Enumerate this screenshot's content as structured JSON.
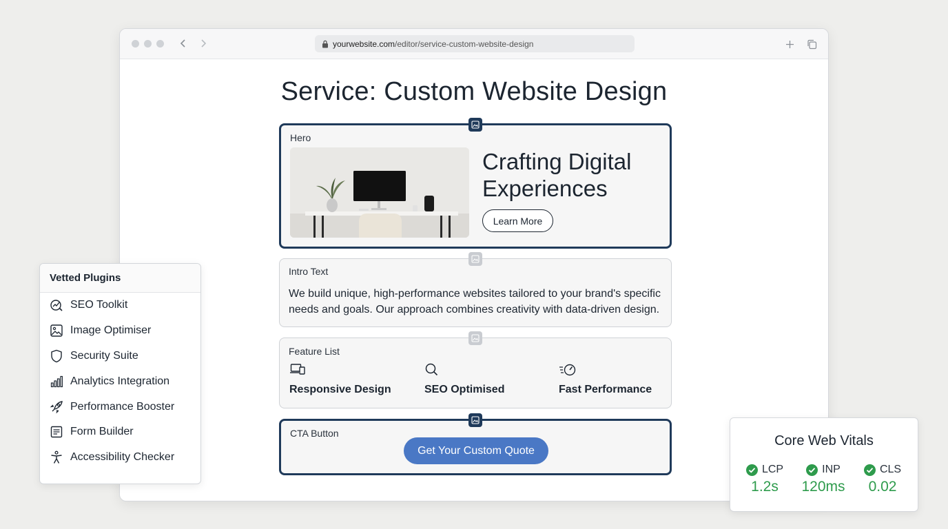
{
  "browser": {
    "url_host": "yourwebsite.com",
    "url_path": "/editor/service-custom-website-design"
  },
  "page": {
    "title": "Service: Custom Website Design"
  },
  "blocks": {
    "hero": {
      "label": "Hero",
      "heading": "Crafting Digital Experiences",
      "button": "Learn More"
    },
    "intro": {
      "label": "Intro Text",
      "text": "We build unique, high-performance websites tailored to your brand's specific needs and goals. Our approach combines creativity with data-driven design."
    },
    "features": {
      "label": "Feature List",
      "items": [
        {
          "icon": "devices-icon",
          "label": "Responsive Design"
        },
        {
          "icon": "search-icon",
          "label": "SEO Optimised"
        },
        {
          "icon": "speedometer-icon",
          "label": "Fast Performance"
        }
      ]
    },
    "cta": {
      "label": "CTA Button",
      "button": "Get Your Custom Quote"
    }
  },
  "plugins": {
    "title": "Vetted Plugins",
    "items": [
      {
        "icon": "seo-chart-icon",
        "label": "SEO Toolkit"
      },
      {
        "icon": "image-icon",
        "label": "Image Optimiser"
      },
      {
        "icon": "shield-icon",
        "label": "Security Suite"
      },
      {
        "icon": "bar-chart-icon",
        "label": "Analytics Integration"
      },
      {
        "icon": "rocket-icon",
        "label": "Performance Booster"
      },
      {
        "icon": "form-icon",
        "label": "Form Builder"
      },
      {
        "icon": "accessibility-icon",
        "label": "Accessibility Checker"
      }
    ]
  },
  "vitals": {
    "title": "Core Web Vitals",
    "metrics": [
      {
        "name": "LCP",
        "value": "1.2s",
        "status": "pass"
      },
      {
        "name": "INP",
        "value": "120ms",
        "status": "pass"
      },
      {
        "name": "CLS",
        "value": "0.02",
        "status": "pass"
      }
    ]
  },
  "colors": {
    "selected_border": "#1f3a5a",
    "cta": "#4a78c5",
    "pass_green": "#2e9b4c"
  }
}
